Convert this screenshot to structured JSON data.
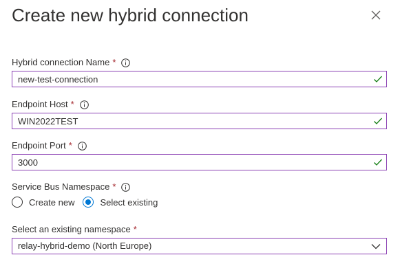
{
  "panel": {
    "title": "Create new hybrid connection",
    "close_icon": "close-icon"
  },
  "form": {
    "connection_name": {
      "label": "Hybrid connection Name",
      "required": "*",
      "value": "new-test-connection",
      "valid": true
    },
    "endpoint_host": {
      "label": "Endpoint Host",
      "required": "*",
      "value": "WIN2022TEST",
      "valid": true
    },
    "endpoint_port": {
      "label": "Endpoint Port",
      "required": "*",
      "value": "3000",
      "valid": true
    },
    "service_bus_namespace": {
      "label": "Service Bus Namespace",
      "required": "*",
      "options": [
        {
          "label": "Create new",
          "selected": false
        },
        {
          "label": "Select existing",
          "selected": true
        }
      ]
    },
    "existing_namespace": {
      "label": "Select an existing namespace",
      "required": "*",
      "selected_value": "relay-hybrid-demo (North Europe)"
    }
  },
  "colors": {
    "field_border": "#8a3fb3",
    "valid_check": "#107c10",
    "required_star": "#a4262c",
    "radio_selected": "#0078d4",
    "text": "#323130"
  }
}
